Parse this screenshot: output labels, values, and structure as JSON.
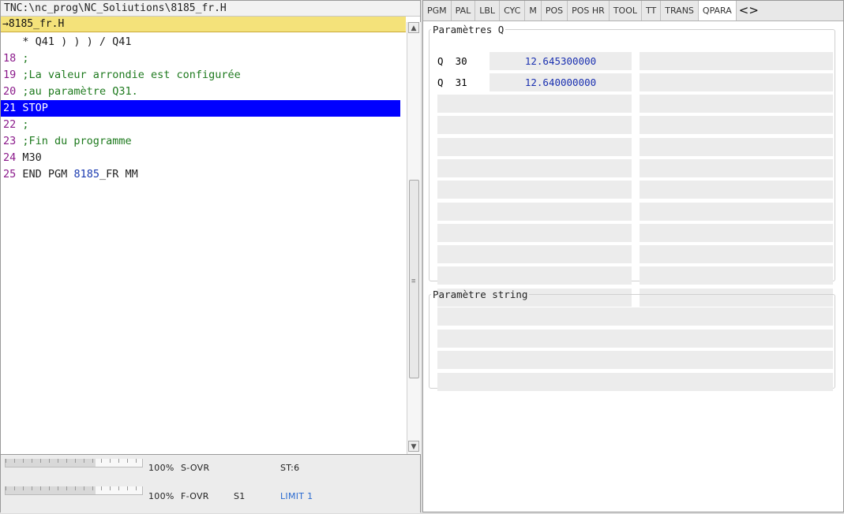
{
  "editor": {
    "path": "TNC:\\nc_prog\\NC_Soliutions\\8185_fr.H",
    "file_marker": "→8185_fr.H",
    "lines": [
      {
        "num": "",
        "text": "   * Q41 ) ) ) / Q41",
        "kind": "plain"
      },
      {
        "num": "18",
        "text": ";",
        "kind": "comment"
      },
      {
        "num": "19",
        "text": ";La valeur arrondie est configurée",
        "kind": "comment"
      },
      {
        "num": "20",
        "text": ";au paramètre Q31.",
        "kind": "comment"
      },
      {
        "num": "21",
        "text": "STOP",
        "kind": "selected"
      },
      {
        "num": "22",
        "text": ";",
        "kind": "comment"
      },
      {
        "num": "23",
        "text": ";Fin du programme",
        "kind": "comment"
      },
      {
        "num": "24",
        "text": "M30",
        "kind": "plain"
      },
      {
        "num": "25",
        "pre": "END PGM ",
        "hl": "8185",
        "post": "_FR MM",
        "kind": "end"
      }
    ]
  },
  "status": {
    "s_ovr_pct": "100%",
    "s_ovr_label": "S-OVR",
    "st_value": "ST:6",
    "f_ovr_pct": "100%",
    "f_ovr_label": "F-OVR",
    "s1": "S1",
    "limit": "LIMIT 1",
    "s_ovr_fill": 0.66,
    "f_ovr_fill": 0.66
  },
  "tabs": [
    "PGM",
    "PAL",
    "LBL",
    "CYC",
    "M",
    "POS",
    "POS HR",
    "TOOL",
    "TT",
    "TRANS",
    "QPARA"
  ],
  "active_tab": "QPARA",
  "qparams": {
    "legend": "Paramètres Q",
    "rows": [
      {
        "label": "Q  30",
        "value": "12.645300000"
      },
      {
        "label": "Q  31",
        "value": "12.640000000"
      }
    ]
  },
  "strparams": {
    "legend": "Paramètre string"
  },
  "colors": {
    "selection": "#0000ff",
    "file_bar": "#f4e27a",
    "line_number": "#8b1a8b",
    "comment": "#1e7a1e",
    "q_value": "#1a30b0"
  }
}
